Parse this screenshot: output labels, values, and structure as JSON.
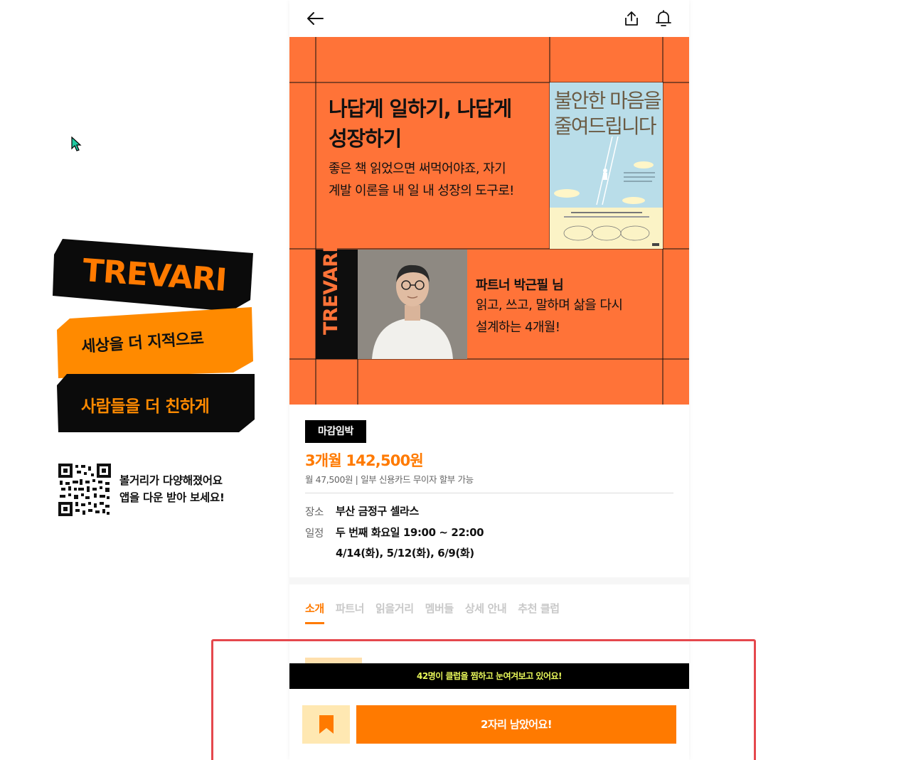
{
  "promo": {
    "brand": "TREVARI",
    "line1": "세상을 더 지적으로",
    "line2": "사람들을 더 친하게",
    "qr_text_1": "볼거리가 다양해졌어요",
    "qr_text_2": "앱을 다운 받아 보세요!",
    "colors": {
      "accent": "#ff8a00",
      "dark": "#000000"
    }
  },
  "topbar": {
    "back_icon": "arrow-left-icon",
    "share_icon": "share-icon",
    "bell_icon": "bell-icon"
  },
  "hero": {
    "title_line1": "나답게 일하기, 나답게",
    "title_line2": "성장하기",
    "sub_line1": "좋은 책 읽었으면 써먹어야죠, 자기",
    "sub_line2": "계발 이론을 내 일 내 성장의 도구로!",
    "book_title_line1": "불안한 마음을",
    "book_title_line2": "줄여드립니다",
    "vertical_brand": "TREVARI",
    "partner_name": "파트너 박근필 님",
    "partner_desc_line1": "읽고, 쓰고, 말하며 삶을 다시",
    "partner_desc_line2": "설계하는 4개월!",
    "background_color": "#ff7338"
  },
  "info": {
    "badge": "마감임박",
    "price": "3개월 142,500원",
    "installment": "월 47,500원 | 일부 신용카드 무이자 할부 가능",
    "place_label": "장소",
    "place_value": "부산 금정구 셀라스",
    "schedule_label": "일정",
    "schedule_value": "두 번째 화요일 19:00 ~ 22:00",
    "schedule_dates": "4/14(화), 5/12(화), 6/9(화)"
  },
  "tabs": [
    "소개",
    "파트너",
    "읽을거리",
    "멤버들",
    "상세 안내",
    "추천 클럽"
  ],
  "bottom": {
    "banner": "42명이 클럽을 찜하고 눈여겨보고 있어요!",
    "bookmark_icon": "bookmark-icon",
    "cta": "2자리 남았어요!"
  }
}
